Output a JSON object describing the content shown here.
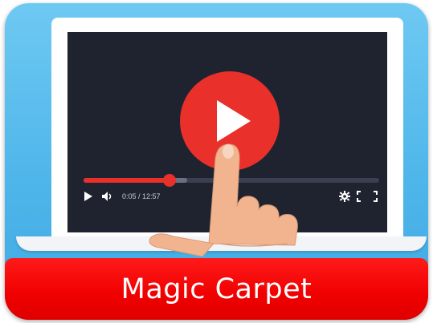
{
  "video_player": {
    "time_display": "0:05 / 12:57",
    "progress": {
      "played_fraction": 0.29,
      "buffered_fraction": 0.35
    },
    "icons": {
      "play_button": "play-icon",
      "play_control": "play-icon",
      "volume": "volume-icon",
      "settings": "gear-icon",
      "fullscreen": "fullscreen-icon"
    }
  },
  "title": "Magic Carpet",
  "colors": {
    "tile_blue": "#4fb6ea",
    "screen_dark": "#1f2330",
    "accent_red": "#e9302a",
    "banner_red": "#f00000",
    "skin": "#f2b48f"
  }
}
